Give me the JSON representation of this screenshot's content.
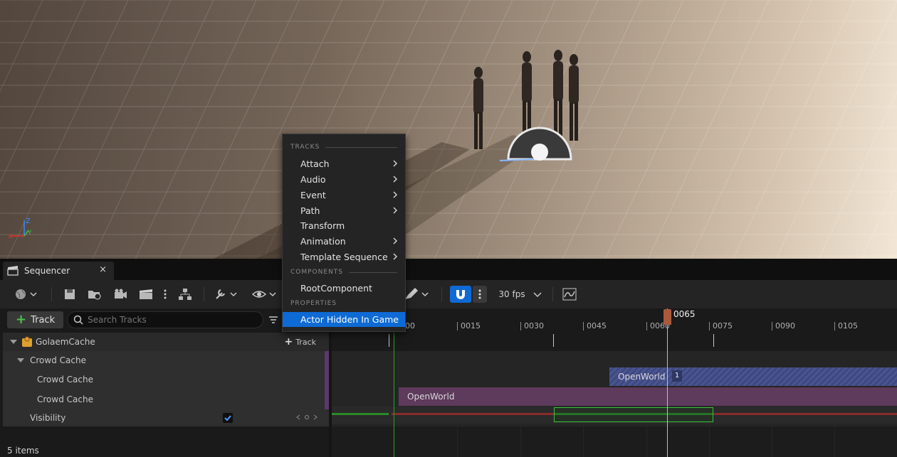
{
  "sequencer": {
    "tab_title": "Sequencer",
    "close_glyph": "×"
  },
  "toolbar": {
    "fps_label": "30 fps"
  },
  "tracks_panel": {
    "add_track_label": "Track",
    "search_placeholder": "Search Tracks",
    "rows": [
      {
        "label": "GolaemCache",
        "track_button": "Track"
      },
      {
        "label": "Crowd Cache"
      },
      {
        "label": "Crowd Cache"
      },
      {
        "label": "Crowd Cache"
      },
      {
        "label": "Visibility",
        "checked": true
      }
    ],
    "status": "5 items"
  },
  "timeline": {
    "playhead_frame": "0065",
    "tick_labels": [
      "00",
      "0015",
      "0030",
      "0045",
      "0060",
      "0075",
      "0090",
      "0105"
    ],
    "sections": [
      {
        "label": "OpenWorld",
        "badge": "1"
      },
      {
        "label": "OpenWorld"
      }
    ]
  },
  "context_menu": {
    "tracks_header": "TRACKS",
    "components_header": "COMPONENTS",
    "properties_header": "PROPERTIES",
    "track_items": [
      "Attach",
      "Audio",
      "Event",
      "Path",
      "Transform",
      "Animation",
      "Template Sequence"
    ],
    "component_items": [
      "RootComponent"
    ],
    "property_items": [
      "Actor Hidden In Game"
    ]
  },
  "colors": {
    "accent": "#0e6ad4",
    "section_blue": "#4a5590",
    "section_purple": "#5e3a5c",
    "key_green": "#3cc13c",
    "key_red": "#a03030"
  }
}
